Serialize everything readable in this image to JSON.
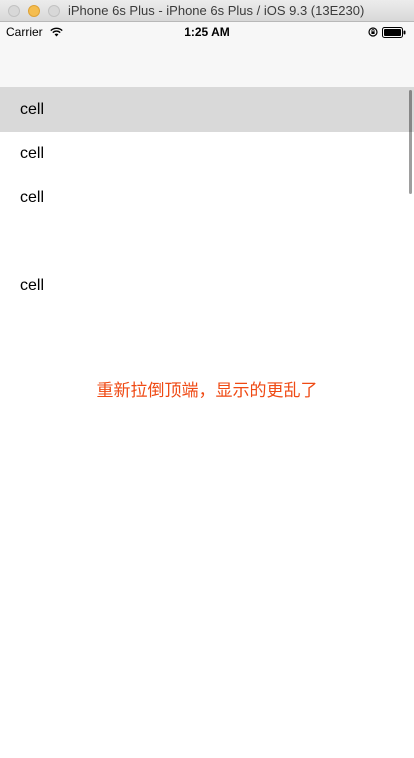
{
  "window": {
    "title": "iPhone 6s Plus - iPhone 6s Plus / iOS 9.3 (13E230)",
    "traffic_lights": [
      "close-icon",
      "minimize-icon",
      "zoom-icon"
    ]
  },
  "status_bar": {
    "carrier": "Carrier",
    "time": "1:25 AM",
    "icons": [
      "wifi-icon",
      "rotation-lock-icon",
      "battery-icon"
    ]
  },
  "table": {
    "rows": [
      {
        "label": "cell",
        "selected": true
      },
      {
        "label": "cell",
        "selected": false
      },
      {
        "label": "cell",
        "selected": false
      },
      {
        "label": "",
        "selected": false
      },
      {
        "label": "cell",
        "selected": false
      }
    ]
  },
  "annotation": {
    "text": "重新拉倒顶端，显示的更乱了",
    "color": "#ef4a14"
  },
  "colors": {
    "selected_row": "#d9d9d9",
    "nav_background": "#f7f7f7"
  }
}
